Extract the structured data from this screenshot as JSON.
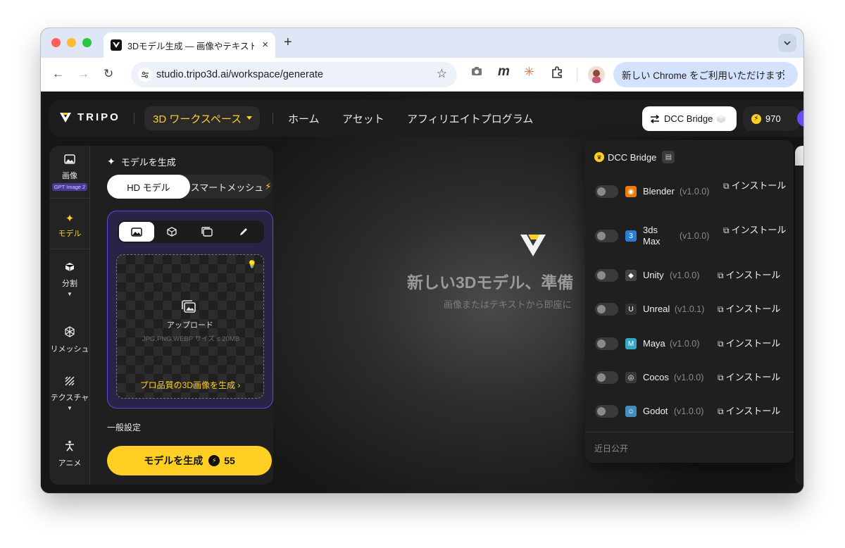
{
  "browser": {
    "tab_title": "3Dモデル生成 — 画像やテキスト",
    "tab_close": "×",
    "new_tab": "+",
    "url": "studio.tripo3d.ai/workspace/generate",
    "update_text": "新しい Chrome をご利用いただけます"
  },
  "header": {
    "logo": "TRIPO",
    "workspace": "3D ワークスペース",
    "nav": [
      "ホーム",
      "アセット",
      "アフィリエイトプログラム"
    ],
    "dcc_bridge": "DCC Bridge",
    "credits": "970"
  },
  "rail": {
    "image": "画像",
    "gpt_tag": "GPT Image 2",
    "model": "モデル",
    "segment": "分割",
    "remesh": "リメッシュ",
    "texture": "テクスチャ",
    "animate": "アニメ"
  },
  "panel": {
    "title": "モデルを生成",
    "seg_hd": "HD モデル",
    "seg_smart": "スマートメッシュ",
    "upload_label": "アップロード",
    "upload_hint": "JPG,PNG,WEBP サイズ ≤ 20MB",
    "pro_link": "プロ品質の3D画像を生成 ›",
    "general": "一般設定",
    "generate_btn": "モデルを生成",
    "generate_cost": "55"
  },
  "center": {
    "title": "新しい3Dモデル、準備",
    "subtitle": "画像またはテキストから即座に"
  },
  "dcc": {
    "title": "DCC Bridge",
    "install_label": "インストール",
    "coming_soon": "近日公开",
    "apps": [
      {
        "name": "Blender",
        "version": "(v1.0.0)",
        "color": "#e87d0d"
      },
      {
        "name": "3ds Max",
        "version": "(v1.0.0)",
        "color": "#2a7fd4"
      },
      {
        "name": "Unity",
        "version": "(v1.0.0)",
        "color": "#444444"
      },
      {
        "name": "Unreal",
        "version": "(v1.0.1)",
        "color": "#333333"
      },
      {
        "name": "Maya",
        "version": "(v1.0.0)",
        "color": "#37a5c6"
      },
      {
        "name": "Cocos",
        "version": "(v1.0.0)",
        "color": "#3a3a3a"
      },
      {
        "name": "Godot",
        "version": "(v1.0.0)",
        "color": "#478cbf"
      }
    ]
  },
  "colors": {
    "accent": "#ffcf23",
    "purple": "#5a4be0",
    "bg": "#161616"
  }
}
